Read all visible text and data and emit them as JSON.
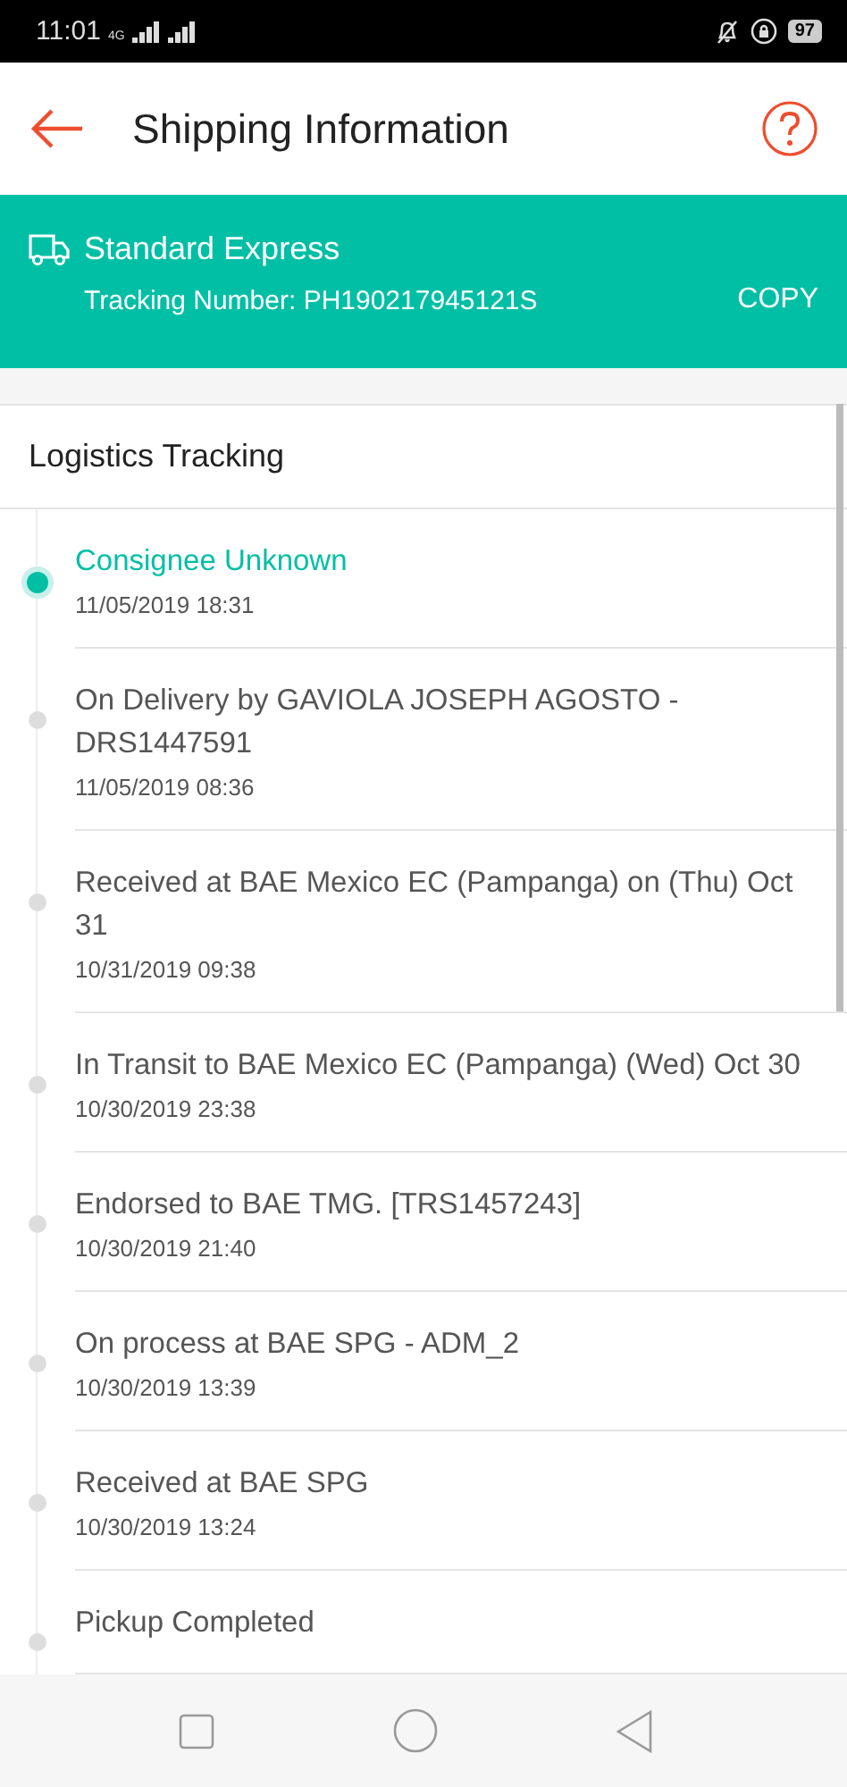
{
  "status_bar": {
    "time": "11:01",
    "network": "4G",
    "battery": "97"
  },
  "header": {
    "title": "Shipping Information"
  },
  "shipment": {
    "service": "Standard Express",
    "tracking_number": "Tracking Number: PH190217945121S",
    "copy_button": "COPY"
  },
  "logistics": {
    "title": "Logistics Tracking",
    "events": [
      {
        "description": "Consignee Unknown",
        "time": "11/05/2019 18:31",
        "current": true
      },
      {
        "description": "On Delivery by GAVIOLA JOSEPH AGOSTO - DRS1447591",
        "time": "11/05/2019 08:36",
        "current": false
      },
      {
        "description": "Received at BAE Mexico EC (Pampanga) on (Thu) Oct 31",
        "time": "10/31/2019 09:38",
        "current": false
      },
      {
        "description": "In Transit to BAE Mexico EC (Pampanga) (Wed) Oct 30",
        "time": "10/30/2019 23:38",
        "current": false
      },
      {
        "description": "Endorsed to BAE TMG. [TRS1457243]",
        "time": "10/30/2019 21:40",
        "current": false
      },
      {
        "description": "On process at BAE SPG - ADM_2",
        "time": "10/30/2019 13:39",
        "current": false
      },
      {
        "description": "Received at BAE SPG",
        "time": "10/30/2019 13:24",
        "current": false
      },
      {
        "description": "Pickup Completed",
        "current": false
      }
    ]
  }
}
